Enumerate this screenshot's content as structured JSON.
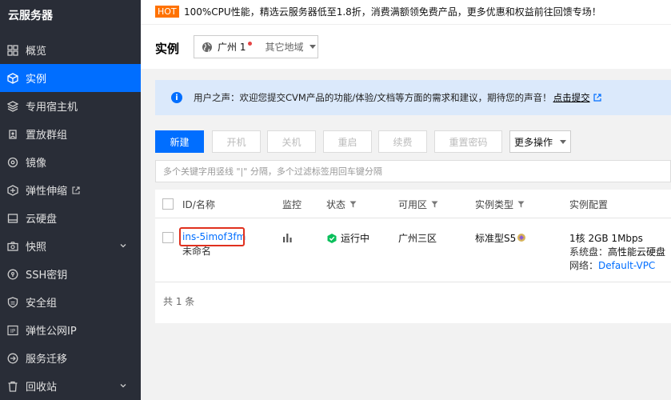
{
  "sidebar": {
    "title": "云服务器",
    "items": [
      {
        "label": "概览",
        "icon": "grid-icon"
      },
      {
        "label": "实例",
        "icon": "cube-icon",
        "active": true
      },
      {
        "label": "专用宿主机",
        "icon": "layers-icon"
      },
      {
        "label": "置放群组",
        "icon": "group-icon"
      },
      {
        "label": "镜像",
        "icon": "disc-icon"
      },
      {
        "label": "弹性伸缩",
        "icon": "scale-icon"
      },
      {
        "label": "云硬盘",
        "icon": "disk-icon"
      },
      {
        "label": "快照",
        "icon": "camera-icon",
        "expandable": true
      },
      {
        "label": "SSH密钥",
        "icon": "key-icon"
      },
      {
        "label": "安全组",
        "icon": "shield-icon"
      },
      {
        "label": "弹性公网IP",
        "icon": "ip-icon"
      },
      {
        "label": "服务迁移",
        "icon": "migrate-icon"
      },
      {
        "label": "回收站",
        "icon": "trash-icon",
        "expandable": true
      }
    ]
  },
  "topbar": {
    "badge": "HOT",
    "promo": "100%CPU性能，精选云服务器低至1.8折，消费满额领免费产品，更多优惠和权益前往回馈专场！"
  },
  "header": {
    "title": "实例",
    "region_current": "广州 1",
    "region_other": "其它地域"
  },
  "notice": {
    "text": "用户之声：欢迎您提交CVM产品的功能/体验/文档等方面的需求和建议，期待您的声音！",
    "link": "点击提交"
  },
  "toolbar": {
    "new": "新建",
    "start": "开机",
    "stop": "关机",
    "restart": "重启",
    "renew": "续费",
    "reset_pwd": "重置密码",
    "more": "更多操作"
  },
  "search": {
    "placeholder": "多个关键字用竖线 \"|\" 分隔，多个过滤标签用回车键分隔"
  },
  "table": {
    "headers": {
      "id": "ID/名称",
      "monitor": "监控",
      "status": "状态",
      "zone": "可用区",
      "type": "实例类型",
      "config": "实例配置"
    },
    "rows": [
      {
        "id": "ins-5imof3fm",
        "name": "未命名",
        "status": "运行中",
        "zone": "广州三区",
        "type": "标准型S5",
        "config_main": "1核 2GB 1Mbps",
        "disk_label": "系统盘：",
        "disk_value": "高性能云硬盘",
        "net_label": "网络：",
        "net_value": "Default-VPC"
      }
    ],
    "footer": "共 1 条"
  },
  "colors": {
    "accent": "#006eff",
    "sidebar_bg": "#292d37",
    "hot": "#ff7200",
    "highlight": "#e0301e",
    "running": "#0abf5b"
  }
}
